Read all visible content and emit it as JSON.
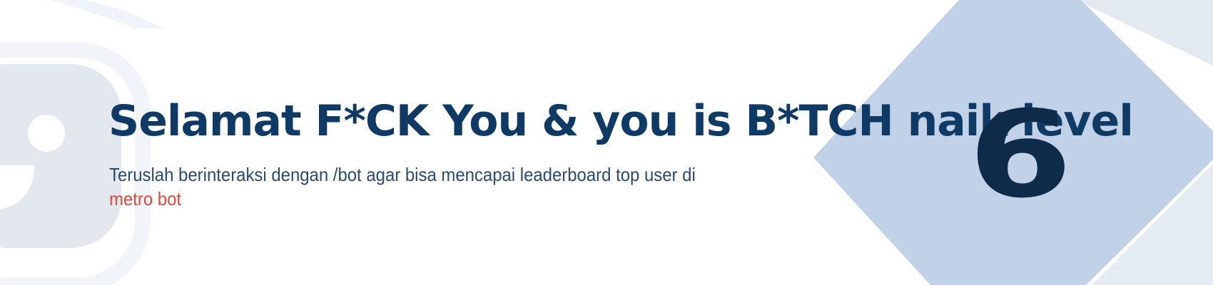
{
  "banner": {
    "title": "Selamat F*CK You & you is B*TCH naik level",
    "subtitle_line1": "Teruslah berinteraksi dengan /bot agar bisa mencapai leaderboard top user di",
    "bot_name": "metro bot",
    "level": "6"
  },
  "colors": {
    "title": "#103a66",
    "subtitle": "#2b4a6e",
    "accent": "#e04a3a",
    "level": "#0e2b4a",
    "diamond": "#c1d2e8",
    "decor": "#e3e9f1"
  }
}
